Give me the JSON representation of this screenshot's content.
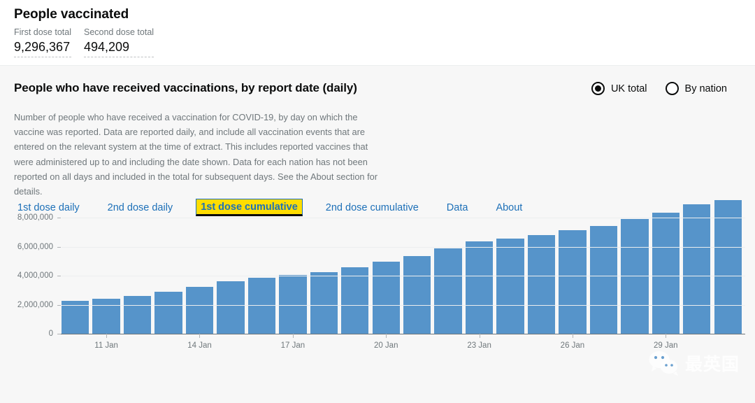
{
  "header": {
    "title": "People vaccinated",
    "stats": [
      {
        "label": "First dose total",
        "value": "9,296,367"
      },
      {
        "label": "Second dose total",
        "value": "494,209"
      }
    ]
  },
  "panel": {
    "title": "People who have received vaccinations, by report date (daily)",
    "description": "Number of people who have received a vaccination for COVID-19, by day on which the vaccine was reported. Data are reported daily, and include all vaccination events that are entered on the relevant system at the time of extract. This includes reported vaccines that were administered up to and including the date shown. Data for each nation has not been reported on all days and included in the total for subsequent days. See the About section for details.",
    "scope_options": [
      {
        "label": "UK total",
        "selected": true
      },
      {
        "label": "By nation",
        "selected": false
      }
    ],
    "tabs": [
      {
        "label": "1st dose daily",
        "active": false
      },
      {
        "label": "2nd dose daily",
        "active": false
      },
      {
        "label": "1st dose cumulative",
        "active": true
      },
      {
        "label": "2nd dose cumulative",
        "active": false
      },
      {
        "label": "Data",
        "active": false
      },
      {
        "label": "About",
        "active": false
      }
    ]
  },
  "watermark": {
    "text": "最英国",
    "icon": "wechat-icon"
  },
  "colors": {
    "bar": "#5694ca",
    "link": "#1d70b8",
    "highlight": "#ffdd00",
    "panel_bg": "#f7f7f7",
    "text": "#0b0c0c",
    "muted": "#6f777b"
  },
  "chart_data": {
    "type": "bar",
    "title": "People who have received vaccinations, by report date (daily)",
    "xlabel": "",
    "ylabel": "",
    "ylim": [
      0,
      9800000
    ],
    "grid": true,
    "legend": false,
    "ytick_labels": [
      "0",
      "2,000,000",
      "4,000,000",
      "6,000,000",
      "8,000,000"
    ],
    "yticks": [
      0,
      2000000,
      4000000,
      6000000,
      8000000
    ],
    "xtick_labels": [
      "11 Jan",
      "14 Jan",
      "17 Jan",
      "20 Jan",
      "23 Jan",
      "26 Jan",
      "29 Jan"
    ],
    "xtick_indices": [
      1,
      4,
      7,
      10,
      13,
      16,
      19
    ],
    "categories": [
      "10 Jan",
      "11 Jan",
      "12 Jan",
      "13 Jan",
      "14 Jan",
      "15 Jan",
      "16 Jan",
      "17 Jan",
      "18 Jan",
      "19 Jan",
      "20 Jan",
      "21 Jan",
      "22 Jan",
      "23 Jan",
      "24 Jan",
      "25 Jan",
      "26 Jan",
      "27 Jan",
      "28 Jan",
      "29 Jan",
      "30 Jan",
      "31 Jan"
    ],
    "values": [
      2250000,
      2420000,
      2600000,
      2880000,
      3250000,
      3600000,
      3880000,
      4080000,
      4260000,
      4600000,
      4970000,
      5380000,
      5880000,
      6350000,
      6570000,
      6820000,
      7140000,
      7440000,
      7900000,
      8370000,
      8930000,
      9230000
    ]
  }
}
